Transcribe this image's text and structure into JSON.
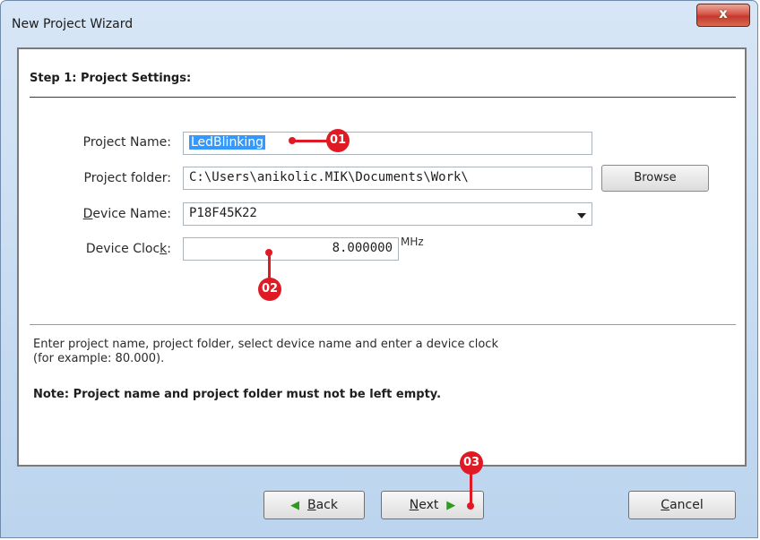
{
  "window": {
    "title": "New Project Wizard",
    "close_label": "x"
  },
  "step": {
    "heading": "Step 1: Project Settings:"
  },
  "form": {
    "project_name": {
      "label": "Project Name:",
      "value": "LedBlinking"
    },
    "project_folder": {
      "label": "Project folder:",
      "value": "C:\\Users\\anikolic.MIK\\Documents\\Work\\",
      "browse_label": "Browse"
    },
    "device_name": {
      "label_underlined": "D",
      "label_rest": "evice Name:",
      "value": "P18F45K22"
    },
    "device_clock": {
      "label_pre": "Device Cloc",
      "label_underlined": "k",
      "label_post": ":",
      "value": "8.000000",
      "unit": "MHz"
    }
  },
  "info": {
    "line1": "Enter project name, project folder, select device name and enter a device clock",
    "line2": "(for example: 80.000).",
    "note": "Note: Project name and project folder must not be left empty."
  },
  "buttons": {
    "back": {
      "icon": "green-left-arrow-icon",
      "label_underlined": "B",
      "label_rest": "ack"
    },
    "next": {
      "icon": "green-right-arrow-icon",
      "label_underlined": "N",
      "label_rest": "ext"
    },
    "cancel": {
      "label_underlined": "C",
      "label_rest": "ancel"
    }
  },
  "annotations": {
    "marker1": "01",
    "marker2": "02",
    "marker3": "03",
    "color": "#e01a24"
  }
}
